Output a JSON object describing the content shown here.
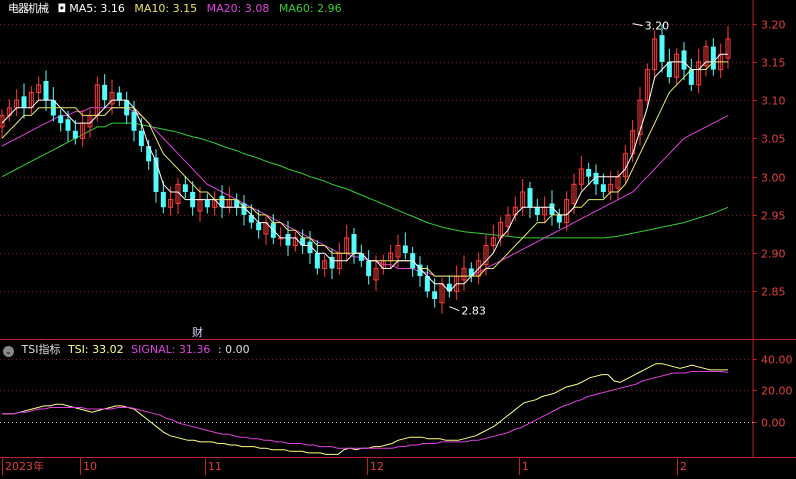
{
  "header": {
    "code_label": "电器机械",
    "ma_icon": "ma-toggle-icon",
    "ma5": "MA5: 3.16",
    "ma10": "MA10: 3.15",
    "ma20": "MA20: 3.08",
    "ma60": "MA60: 2.96"
  },
  "indicator": {
    "name": "TSI指标",
    "tsi": "TSI: 33.02",
    "signal": "SIGNAL: 31.36",
    "extra": ": 0.00",
    "marker": "财"
  },
  "colors": {
    "up": "#ff3c3c",
    "down": "#54fcfc",
    "ma5": "#ffffff",
    "ma10": "#e8e860",
    "ma20": "#e040e0",
    "ma60": "#30d030",
    "tsi": "#ffff80",
    "signal": "#e040e0",
    "axis": "#c02020"
  },
  "chart_data": [
    {
      "type": "candlestick",
      "title": "",
      "ylim": [
        2.81,
        3.21
      ],
      "yticks": [
        "3.20",
        "3.15",
        "3.10",
        "3.05",
        "3.00",
        "2.95",
        "2.90",
        "2.85"
      ],
      "ytick_values": [
        3.2,
        3.15,
        3.1,
        3.05,
        3.0,
        2.95,
        2.9,
        2.85
      ],
      "annotations": [
        {
          "label": "3.20",
          "value": 3.2
        },
        {
          "label": "2.83",
          "value": 2.83
        }
      ],
      "closes": [
        3.08,
        3.09,
        3.1,
        3.09,
        3.11,
        3.12,
        3.1,
        3.08,
        3.07,
        3.06,
        3.05,
        3.07,
        3.08,
        3.12,
        3.1,
        3.11,
        3.1,
        3.08,
        3.06,
        3.04,
        3.02,
        2.98,
        2.96,
        2.97,
        2.99,
        2.98,
        2.96,
        2.97,
        2.96,
        2.97,
        2.96,
        2.97,
        2.96,
        2.95,
        2.94,
        2.93,
        2.94,
        2.92,
        2.92,
        2.91,
        2.92,
        2.91,
        2.9,
        2.88,
        2.89,
        2.88,
        2.9,
        2.92,
        2.9,
        2.89,
        2.87,
        2.88,
        2.89,
        2.9,
        2.91,
        2.9,
        2.88,
        2.87,
        2.85,
        2.84,
        2.86,
        2.85,
        2.87,
        2.88,
        2.87,
        2.89,
        2.91,
        2.92,
        2.94,
        2.95,
        2.96,
        2.98,
        2.96,
        2.95,
        2.96,
        2.95,
        2.94,
        2.97,
        2.99,
        3.01,
        3.0,
        2.99,
        2.98,
        2.99,
        3.0,
        3.03,
        3.06,
        3.1,
        3.14,
        3.18,
        3.15,
        3.13,
        3.16,
        3.14,
        3.12,
        3.15,
        3.17,
        3.14,
        3.16,
        3.18
      ],
      "ma5": [
        3.07,
        3.08,
        3.09,
        3.09,
        3.09,
        3.1,
        3.1,
        3.1,
        3.09,
        3.08,
        3.07,
        3.07,
        3.07,
        3.08,
        3.09,
        3.1,
        3.1,
        3.1,
        3.09,
        3.07,
        3.04,
        3.02,
        2.99,
        2.98,
        2.98,
        2.97,
        2.97,
        2.97,
        2.97,
        2.97,
        2.96,
        2.96,
        2.96,
        2.96,
        2.95,
        2.94,
        2.94,
        2.93,
        2.92,
        2.92,
        2.92,
        2.91,
        2.91,
        2.9,
        2.9,
        2.89,
        2.89,
        2.89,
        2.9,
        2.9,
        2.89,
        2.89,
        2.88,
        2.88,
        2.89,
        2.89,
        2.89,
        2.88,
        2.87,
        2.86,
        2.86,
        2.85,
        2.86,
        2.86,
        2.87,
        2.88,
        2.89,
        2.9,
        2.92,
        2.93,
        2.95,
        2.96,
        2.96,
        2.96,
        2.96,
        2.96,
        2.95,
        2.95,
        2.96,
        2.98,
        2.99,
        3.0,
        3.0,
        3.0,
        3.0,
        3.01,
        3.03,
        3.06,
        3.09,
        3.13,
        3.14,
        3.15,
        3.15,
        3.15,
        3.14,
        3.14,
        3.15,
        3.15,
        3.16,
        3.16
      ],
      "ma10": [
        3.05,
        3.06,
        3.07,
        3.08,
        3.08,
        3.09,
        3.09,
        3.09,
        3.09,
        3.09,
        3.09,
        3.08,
        3.08,
        3.08,
        3.08,
        3.09,
        3.09,
        3.09,
        3.09,
        3.08,
        3.07,
        3.05,
        3.03,
        3.02,
        3.01,
        3.0,
        2.99,
        2.98,
        2.98,
        2.97,
        2.97,
        2.97,
        2.97,
        2.96,
        2.96,
        2.95,
        2.95,
        2.94,
        2.94,
        2.93,
        2.93,
        2.92,
        2.92,
        2.91,
        2.91,
        2.9,
        2.9,
        2.9,
        2.9,
        2.9,
        2.89,
        2.89,
        2.89,
        2.89,
        2.89,
        2.89,
        2.89,
        2.88,
        2.88,
        2.87,
        2.87,
        2.87,
        2.87,
        2.87,
        2.87,
        2.87,
        2.88,
        2.88,
        2.89,
        2.9,
        2.91,
        2.92,
        2.93,
        2.94,
        2.94,
        2.95,
        2.95,
        2.95,
        2.96,
        2.96,
        2.97,
        2.97,
        2.97,
        2.98,
        2.98,
        2.99,
        3.01,
        3.03,
        3.05,
        3.07,
        3.09,
        3.11,
        3.12,
        3.13,
        3.14,
        3.14,
        3.14,
        3.15,
        3.15,
        3.15
      ],
      "ma20": [
        3.04,
        3.045,
        3.05,
        3.055,
        3.06,
        3.065,
        3.07,
        3.075,
        3.08,
        3.08,
        3.085,
        3.085,
        3.09,
        3.09,
        3.09,
        3.09,
        3.09,
        3.09,
        3.085,
        3.08,
        3.07,
        3.06,
        3.05,
        3.04,
        3.03,
        3.02,
        3.01,
        3.0,
        2.99,
        2.985,
        2.98,
        2.975,
        2.97,
        2.965,
        2.96,
        2.955,
        2.95,
        2.945,
        2.94,
        2.935,
        2.93,
        2.925,
        2.92,
        2.915,
        2.91,
        2.905,
        2.9,
        2.9,
        2.895,
        2.895,
        2.89,
        2.89,
        2.885,
        2.885,
        2.88,
        2.88,
        2.88,
        2.875,
        2.875,
        2.87,
        2.87,
        2.87,
        2.87,
        2.87,
        2.87,
        2.875,
        2.88,
        2.885,
        2.89,
        2.895,
        2.9,
        2.905,
        2.91,
        2.915,
        2.92,
        2.925,
        2.93,
        2.935,
        2.94,
        2.945,
        2.95,
        2.955,
        2.96,
        2.965,
        2.97,
        2.975,
        2.98,
        2.99,
        3.0,
        3.01,
        3.02,
        3.03,
        3.04,
        3.05,
        3.055,
        3.06,
        3.065,
        3.07,
        3.075,
        3.08
      ],
      "ma60": [
        3.0,
        3.005,
        3.01,
        3.015,
        3.02,
        3.025,
        3.03,
        3.035,
        3.04,
        3.045,
        3.05,
        3.055,
        3.06,
        3.065,
        3.065,
        3.07,
        3.07,
        3.07,
        3.07,
        3.068,
        3.066,
        3.064,
        3.062,
        3.06,
        3.058,
        3.055,
        3.052,
        3.05,
        3.047,
        3.044,
        3.04,
        3.037,
        3.034,
        3.03,
        3.027,
        3.024,
        3.02,
        3.017,
        3.014,
        3.01,
        3.007,
        3.004,
        3.0,
        2.997,
        2.994,
        2.99,
        2.987,
        2.984,
        2.98,
        2.976,
        2.972,
        2.968,
        2.964,
        2.96,
        2.956,
        2.952,
        2.948,
        2.944,
        2.94,
        2.937,
        2.934,
        2.932,
        2.93,
        2.928,
        2.927,
        2.926,
        2.925,
        2.924,
        2.923,
        2.922,
        2.921,
        2.92,
        2.92,
        2.92,
        2.92,
        2.92,
        2.92,
        2.92,
        2.92,
        2.92,
        2.92,
        2.92,
        2.92,
        2.921,
        2.922,
        2.924,
        2.926,
        2.928,
        2.93,
        2.932,
        2.934,
        2.936,
        2.938,
        2.94,
        2.943,
        2.946,
        2.949,
        2.952,
        2.956,
        2.96
      ]
    },
    {
      "type": "line",
      "title": "",
      "ylim": [
        -22,
        47
      ],
      "yticks": [
        "40.00",
        "20.00",
        "0.00"
      ],
      "ytick_values": [
        40,
        20,
        0
      ],
      "series": [
        {
          "name": "TSI",
          "values": [
            5,
            5,
            5,
            6,
            7,
            8,
            9,
            10,
            10,
            11,
            11,
            10,
            9,
            8,
            7,
            6,
            7,
            8,
            9,
            10,
            10,
            9,
            8,
            5,
            2,
            -1,
            -4,
            -7,
            -9,
            -10,
            -11,
            -12,
            -12,
            -13,
            -13,
            -13,
            -14,
            -14,
            -15,
            -15,
            -16,
            -16,
            -16,
            -17,
            -17,
            -18,
            -18,
            -18,
            -19,
            -19,
            -19,
            -20,
            -20,
            -20,
            -21,
            -21,
            -21,
            -18,
            -17,
            -18,
            -17,
            -17,
            -16,
            -16,
            -15,
            -14,
            -12,
            -11,
            -10,
            -10,
            -10,
            -11,
            -11,
            -11,
            -12,
            -12,
            -12,
            -11,
            -10,
            -9,
            -7,
            -5,
            -3,
            0,
            3,
            6,
            9,
            12,
            13,
            14,
            16,
            17,
            18,
            20,
            22,
            23,
            24,
            26,
            28,
            29,
            30,
            30,
            26,
            25,
            27,
            29,
            31,
            33,
            35,
            37,
            37,
            36,
            35,
            34,
            35,
            36,
            35,
            34,
            33,
            33,
            33,
            33
          ]
        },
        {
          "name": "SIGNAL",
          "values": [
            5,
            5,
            5,
            6,
            6,
            7,
            8,
            8,
            9,
            9,
            9,
            9,
            9,
            9,
            8,
            8,
            8,
            8,
            8,
            9,
            9,
            9,
            8,
            7,
            6,
            5,
            4,
            2,
            1,
            -1,
            -2,
            -3,
            -4,
            -5,
            -6,
            -7,
            -8,
            -8,
            -9,
            -10,
            -10,
            -11,
            -11,
            -12,
            -12,
            -13,
            -13,
            -14,
            -14,
            -14,
            -15,
            -15,
            -16,
            -16,
            -16,
            -17,
            -17,
            -17,
            -17,
            -17,
            -17,
            -17,
            -17,
            -17,
            -17,
            -16,
            -16,
            -15,
            -15,
            -14,
            -14,
            -14,
            -13,
            -13,
            -13,
            -13,
            -13,
            -12,
            -12,
            -11,
            -10,
            -9,
            -8,
            -7,
            -5,
            -4,
            -2,
            0,
            2,
            4,
            6,
            8,
            10,
            11,
            13,
            14,
            16,
            17,
            18,
            19,
            20,
            21,
            22,
            23,
            24,
            26,
            27,
            28,
            29,
            30,
            31,
            31,
            31,
            32,
            32,
            32,
            32,
            32,
            32,
            31.36
          ]
        }
      ]
    }
  ],
  "xaxis": {
    "labels": [
      "2023年",
      "10",
      "11",
      "12",
      "1",
      "2"
    ]
  }
}
